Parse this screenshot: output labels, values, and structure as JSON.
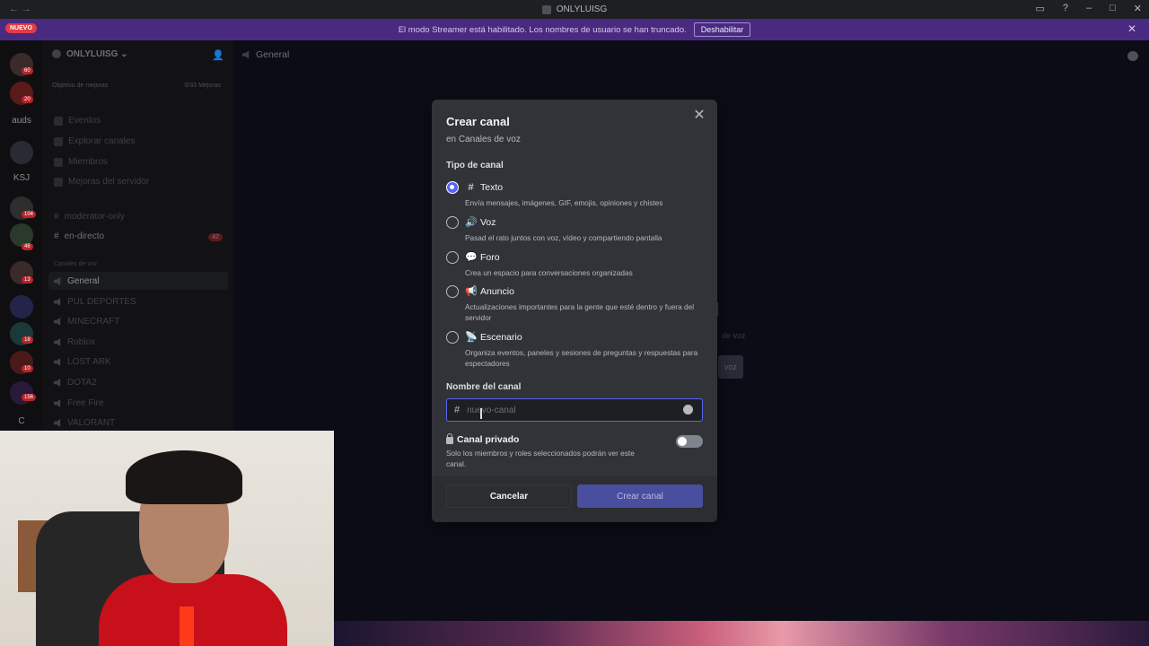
{
  "window": {
    "title": "ONLYLUISG"
  },
  "banner": {
    "new_badge": "NUEVO",
    "text": "El modo Streamer está habilitado. Los nombres de usuario se han truncado.",
    "button": "Deshabilitar"
  },
  "rail": {
    "badges": [
      "60",
      "20",
      "104",
      "46",
      "13",
      "18",
      "10",
      "156"
    ],
    "labels": [
      "auds",
      "KSJ",
      "C"
    ]
  },
  "sidebar": {
    "server_name": "ONLYLUISG",
    "goal_label": "Objetivo de mejoras",
    "goal_progress": "0/33 Mejoras",
    "nav": [
      "Eventos",
      "Explorar canales",
      "Miembros",
      "Mejoras del servidor"
    ],
    "text_channels": [
      "moderator-only",
      "en-directo"
    ],
    "en_directo_count": "42",
    "voice_category": "Canales de voz",
    "voice_channels": [
      "General",
      "PUL DEPORTES",
      "MINECRAFT",
      "Roblox",
      "LOST ARK",
      "DOTA2",
      "Free Fire",
      "VALORANT"
    ]
  },
  "main": {
    "channel": "General",
    "bg_fragment_1": "de voz",
    "bg_fragment_2": "voz",
    "bg_fragment_3": "l"
  },
  "modal": {
    "title": "Crear canal",
    "subtitle": "en Canales de voz",
    "type_label": "Tipo de canal",
    "options": [
      {
        "icon": "#",
        "label": "Texto",
        "desc": "Envía mensajes, imágenes, GIF, emojis, opiniones y chistes",
        "selected": true
      },
      {
        "icon": "🔊",
        "label": "Voz",
        "desc": "Pasad el rato juntos con voz, vídeo y compartiendo pantalla",
        "selected": false
      },
      {
        "icon": "💬",
        "label": "Foro",
        "desc": "Crea un espacio para conversaciones organizadas",
        "selected": false
      },
      {
        "icon": "📢",
        "label": "Anuncio",
        "desc": "Actualizaciones importantes para la gente que esté dentro y fuera del servidor",
        "selected": false
      },
      {
        "icon": "📡",
        "label": "Escenario",
        "desc": "Organiza eventos, paneles y sesiones de preguntas y respuestas para espectadores",
        "selected": false
      }
    ],
    "name_label": "Nombre del canal",
    "name_placeholder": "nuevo-canal",
    "name_value": "",
    "private_label": "Canal privado",
    "private_desc": "Solo los miembros y roles seleccionados podrán ver este canal.",
    "private_enabled": false,
    "cancel": "Cancelar",
    "create": "Crear canal"
  },
  "colors": {
    "accent": "#5865f2",
    "modal_bg": "#313338",
    "banner": "#4a2a80"
  }
}
